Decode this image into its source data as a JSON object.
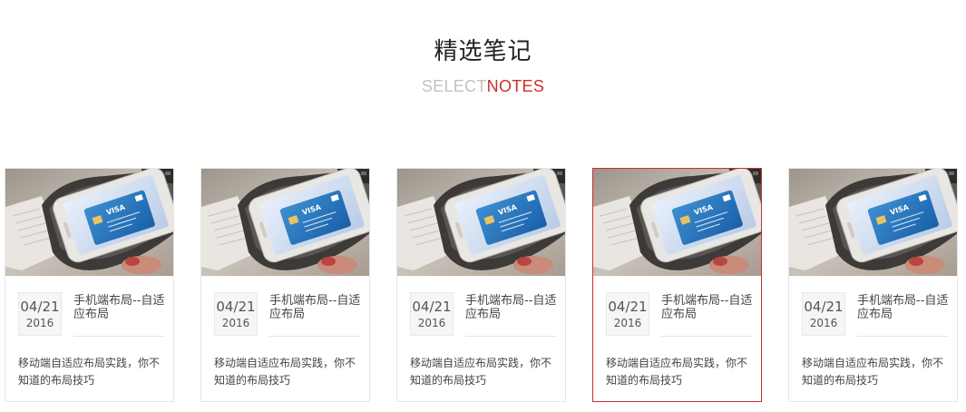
{
  "section": {
    "title": "精选笔记",
    "subtitle_gray": "SELECT",
    "subtitle_red": "NOTES"
  },
  "colors": {
    "accent_red": "#c9302c",
    "subtitle_gray": "#c2c2c2",
    "card_border": "#e6e6e6"
  },
  "cards": [
    {
      "date_md": "04/21",
      "year": "2016",
      "title": "手机端布局--自适应布局",
      "desc": "移动端自适应布局实践，你不知道的布局技巧",
      "image_icon": "phone-payment-photo",
      "active": false
    },
    {
      "date_md": "04/21",
      "year": "2016",
      "title": "手机端布局--自适应布局",
      "desc": "移动端自适应布局实践，你不知道的布局技巧",
      "image_icon": "phone-payment-photo",
      "active": false
    },
    {
      "date_md": "04/21",
      "year": "2016",
      "title": "手机端布局--自适应布局",
      "desc": "移动端自适应布局实践，你不知道的布局技巧",
      "image_icon": "phone-payment-photo",
      "active": false
    },
    {
      "date_md": "04/21",
      "year": "2016",
      "title": "手机端布局--自适应布局",
      "desc": "移动端自适应布局实践，你不知道的布局技巧",
      "image_icon": "phone-payment-photo",
      "active": true
    },
    {
      "date_md": "04/21",
      "year": "2016",
      "title": "手机端布局--自适应布局",
      "desc": "移动端自适应布局实践，你不知道的布局技巧",
      "image_icon": "phone-payment-photo",
      "active": false
    }
  ]
}
